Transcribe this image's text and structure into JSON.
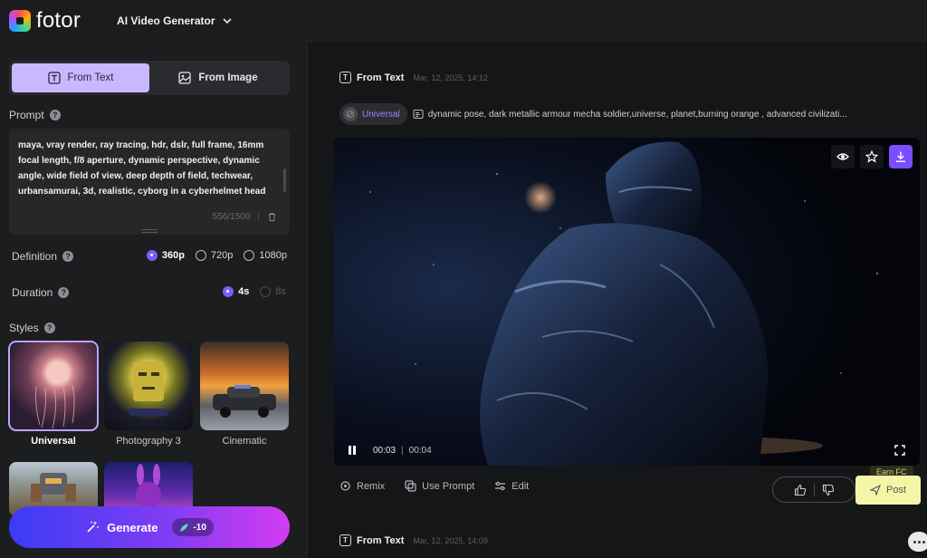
{
  "header": {
    "brand": "fotor",
    "tool_name": "AI Video Generator"
  },
  "left_panel": {
    "mode_tabs": [
      {
        "label": "From Text",
        "active": true,
        "icon": "text-box-icon"
      },
      {
        "label": "From Image",
        "active": false,
        "icon": "image-icon"
      }
    ],
    "prompt": {
      "label": "Prompt",
      "text": "maya, vray render, ray tracing, hdr, dslr, full frame, 16mm focal length, f/8 aperture, dynamic perspective, dynamic angle, wide field of view, deep depth of field, techwear, urbansamurai, 3d, realistic, cyborg in a cyberhelmet head",
      "char_count": "556/1500"
    },
    "definition": {
      "label": "Definition",
      "options": [
        {
          "label": "360p",
          "checked": true
        },
        {
          "label": "720p",
          "checked": false
        },
        {
          "label": "1080p",
          "checked": false
        }
      ]
    },
    "duration": {
      "label": "Duration",
      "options": [
        {
          "label": "4s",
          "checked": true
        },
        {
          "label": "8s",
          "checked": false,
          "disabled": true
        }
      ]
    },
    "styles": {
      "label": "Styles",
      "items": [
        {
          "label": "Universal",
          "selected": true
        },
        {
          "label": "Photography 3",
          "selected": false
        },
        {
          "label": "Cinematic",
          "selected": false
        },
        {
          "label": "",
          "selected": false
        },
        {
          "label": "",
          "selected": false
        }
      ]
    },
    "generate": {
      "label": "Generate",
      "cost": "-10"
    }
  },
  "feed": {
    "entries": [
      {
        "type": "From Text",
        "date": "Mar, 12, 2025, 14:12",
        "style_tag": "Universal",
        "prompt_preview": "dynamic pose, dark metallic armour mecha soldier,universe, planet,burning orange , advanced civilizati...",
        "video": {
          "current_time": "00:03",
          "duration": "00:04"
        },
        "actions": [
          "Remix",
          "Use Prompt",
          "Edit"
        ],
        "earn_badge": "Earn FC",
        "post_label": "Post"
      },
      {
        "type": "From Text",
        "date": "Mar, 12, 2025, 14:09"
      }
    ]
  },
  "colors": {
    "accent": "#7b5cff",
    "tab_active": "#c9b8ff",
    "post_button": "#f5f5a8"
  }
}
